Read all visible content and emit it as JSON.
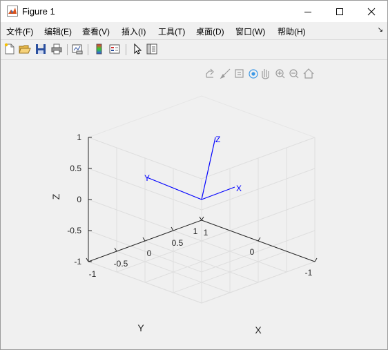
{
  "window": {
    "title": "Figure 1"
  },
  "menu": [
    "文件(F)",
    "编辑(E)",
    "查看(V)",
    "插入(I)",
    "工具(T)",
    "桌面(D)",
    "窗口(W)",
    "帮助(H)"
  ],
  "toolbar": {
    "buttons": [
      "new-figure",
      "open-file",
      "save",
      "print",
      "link-plot",
      "insert-colorbar",
      "insert-legend",
      "edit-plot",
      "property-inspector"
    ]
  },
  "axes_toolbar": [
    "export",
    "brush",
    "data-tips",
    "rotate-3d",
    "pan",
    "zoom-in",
    "zoom-out",
    "home"
  ],
  "chart_data": {
    "type": "line",
    "view": "3d",
    "xlabel": "X",
    "ylabel": "Y",
    "zlabel": "Z",
    "xlim": [
      -1,
      1
    ],
    "ylim": [
      -1,
      1
    ],
    "zlim": [
      -1,
      1
    ],
    "x_ticks": [
      "-1",
      "-0.5",
      "0",
      "0.5",
      "1"
    ],
    "y_ticks": [
      "1",
      "0",
      "-1"
    ],
    "z_ticks": [
      "1",
      "0.5",
      "0",
      "-0.5",
      "-1"
    ],
    "grid": true,
    "series_color": "#0000ff",
    "triad": [
      {
        "name": "X",
        "end": [
          1,
          0,
          0
        ]
      },
      {
        "name": "Y",
        "end": [
          0,
          1,
          0
        ]
      },
      {
        "name": "Z",
        "end": [
          0,
          0,
          1
        ]
      }
    ]
  }
}
